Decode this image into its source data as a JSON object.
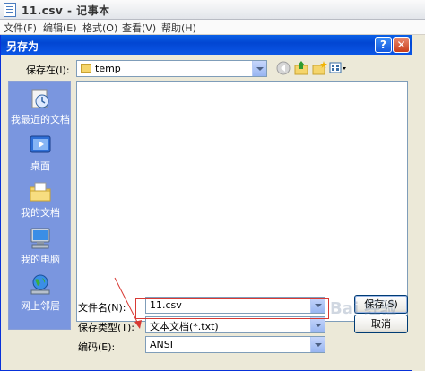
{
  "notepad": {
    "title": "11.csv - 记事本",
    "menu": [
      "文件(F)",
      "编辑(E)",
      "格式(O)",
      "查看(V)",
      "帮助(H)"
    ]
  },
  "dialog": {
    "title": "另存为",
    "help_button": "?",
    "close_button": "✕",
    "save_in_label": "保存在(I):",
    "save_in_value": "temp",
    "places": [
      {
        "label": "我最近的文档",
        "icon": "recent-documents-icon"
      },
      {
        "label": "桌面",
        "icon": "desktop-icon"
      },
      {
        "label": "我的文档",
        "icon": "my-documents-icon"
      },
      {
        "label": "我的电脑",
        "icon": "my-computer-icon"
      },
      {
        "label": "网上邻居",
        "icon": "network-places-icon"
      }
    ],
    "filename_label": "文件名(N):",
    "filename_value": "11.csv",
    "filetype_label": "保存类型(T):",
    "filetype_value": "文本文档(*.txt)",
    "encoding_label": "编码(E):",
    "encoding_value": "ANSI",
    "save_button": "保存(S)",
    "cancel_button": "取消"
  },
  "watermark": "Bai 经验",
  "colors": {
    "title_blue": "#0a5fe6",
    "places_blue": "#7a96df",
    "highlight_red": "#d83a34"
  }
}
